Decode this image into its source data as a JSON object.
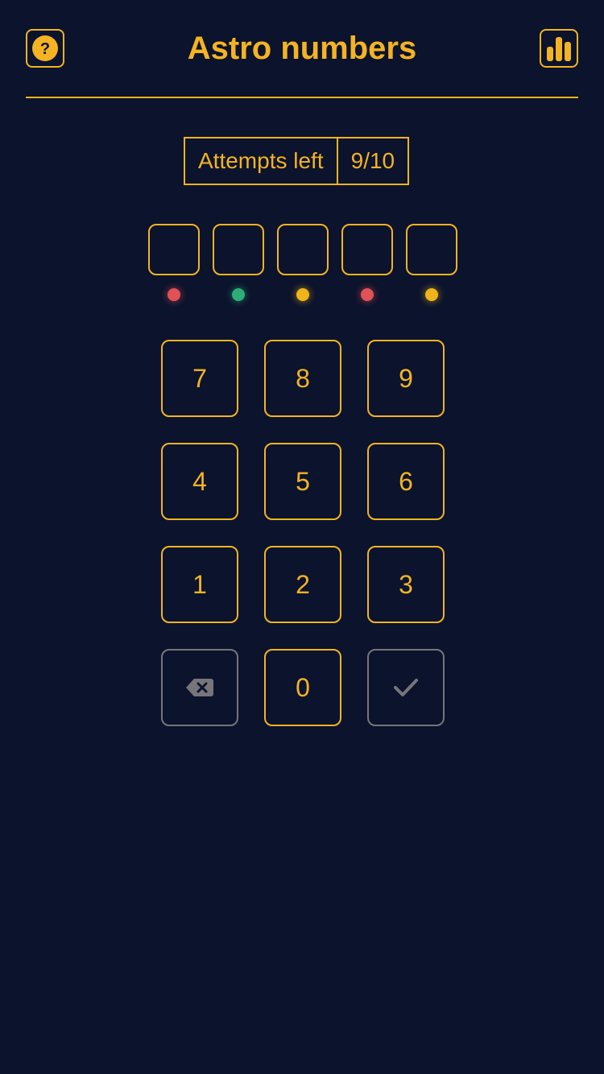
{
  "header": {
    "title": "Astro numbers",
    "help_icon": "question-mark-circle-icon",
    "stats_icon": "bar-chart-icon"
  },
  "attempts": {
    "label": "Attempts left",
    "value": "9/10"
  },
  "slots": [
    {
      "value": "",
      "indicator": "#e05255"
    },
    {
      "value": "",
      "indicator": "#2dae76"
    },
    {
      "value": "",
      "indicator": "#f1b418"
    },
    {
      "value": "",
      "indicator": "#e05255"
    },
    {
      "value": "",
      "indicator": "#f1b418"
    }
  ],
  "keypad": {
    "keys": [
      "7",
      "8",
      "9",
      "4",
      "5",
      "6",
      "1",
      "2",
      "3"
    ],
    "zero": "0",
    "backspace_icon": "backspace-icon",
    "submit_icon": "checkmark-icon"
  },
  "colors": {
    "accent": "#f4b323",
    "background": "#0b132d",
    "disabled": "#77757a"
  }
}
